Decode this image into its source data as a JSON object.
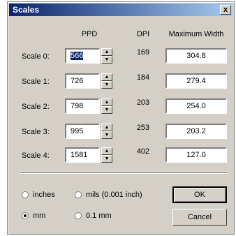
{
  "window": {
    "title": "Scales",
    "close_label": "x"
  },
  "headers": {
    "ppd": "PPD",
    "dpi": "DPI",
    "max_width": "Maximum Width"
  },
  "rows": [
    {
      "label": "Scale 0:",
      "ppd": "566",
      "dpi": "169",
      "max_width": "304.8"
    },
    {
      "label": "Scale 1:",
      "ppd": "726",
      "dpi": "184",
      "max_width": "279.4"
    },
    {
      "label": "Scale 2:",
      "ppd": "798",
      "dpi": "203",
      "max_width": "254.0"
    },
    {
      "label": "Scale 3:",
      "ppd": "995",
      "dpi": "253",
      "max_width": "203.2"
    },
    {
      "label": "Scale 4:",
      "ppd": "1581",
      "dpi": "402",
      "max_width": "127.0"
    }
  ],
  "units": [
    {
      "label": "inches",
      "selected": false
    },
    {
      "label": "mils (0.001 inch)",
      "selected": false
    },
    {
      "label": "mm",
      "selected": true
    },
    {
      "label": "0.1 mm",
      "selected": false
    }
  ],
  "buttons": {
    "ok": "OK",
    "cancel": "Cancel"
  }
}
